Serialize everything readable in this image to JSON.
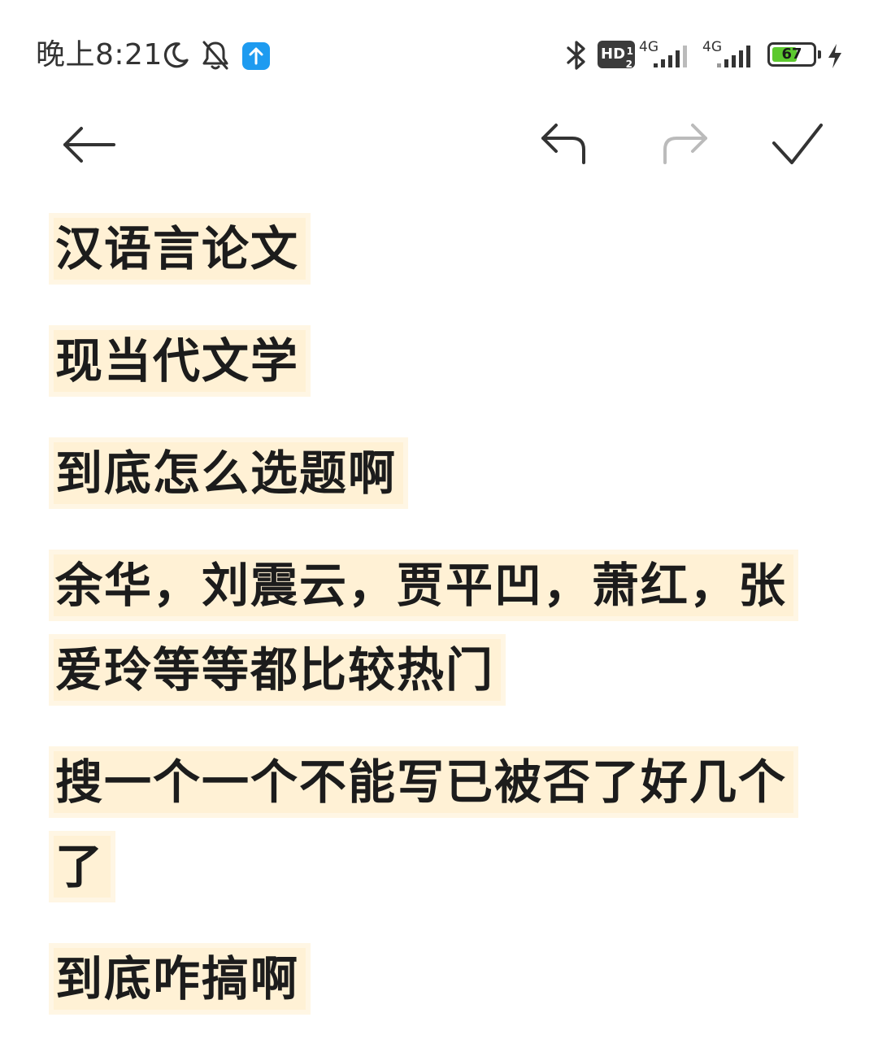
{
  "status_bar": {
    "time": "晚上8:21",
    "hd_label": "HD",
    "hd_sup": "1",
    "hd_sub": "2",
    "network1": "4G",
    "network2": "4G",
    "battery_percent": "67",
    "battery_level": 0.67,
    "colors": {
      "app_badge": "#1e9bf0",
      "battery_fill": "#5cc92e"
    },
    "icons": [
      "moon-icon",
      "bell-off-icon",
      "upload-app-icon",
      "bluetooth-icon",
      "signal-icon",
      "battery-icon",
      "charging-icon"
    ]
  },
  "toolbar": {
    "icons": [
      "back-arrow-icon",
      "undo-icon",
      "redo-icon",
      "check-icon"
    ],
    "redo_enabled": false
  },
  "note": {
    "highlight_color": "#fff1d5",
    "lines": [
      "汉语言论文",
      "现当代文学",
      "到底怎么选题啊",
      "余华，刘震云，贾平凹，萧红，张爱玲等等都比较热门",
      "搜一个一个不能写已被否了好几个了",
      "到底咋搞啊"
    ]
  }
}
